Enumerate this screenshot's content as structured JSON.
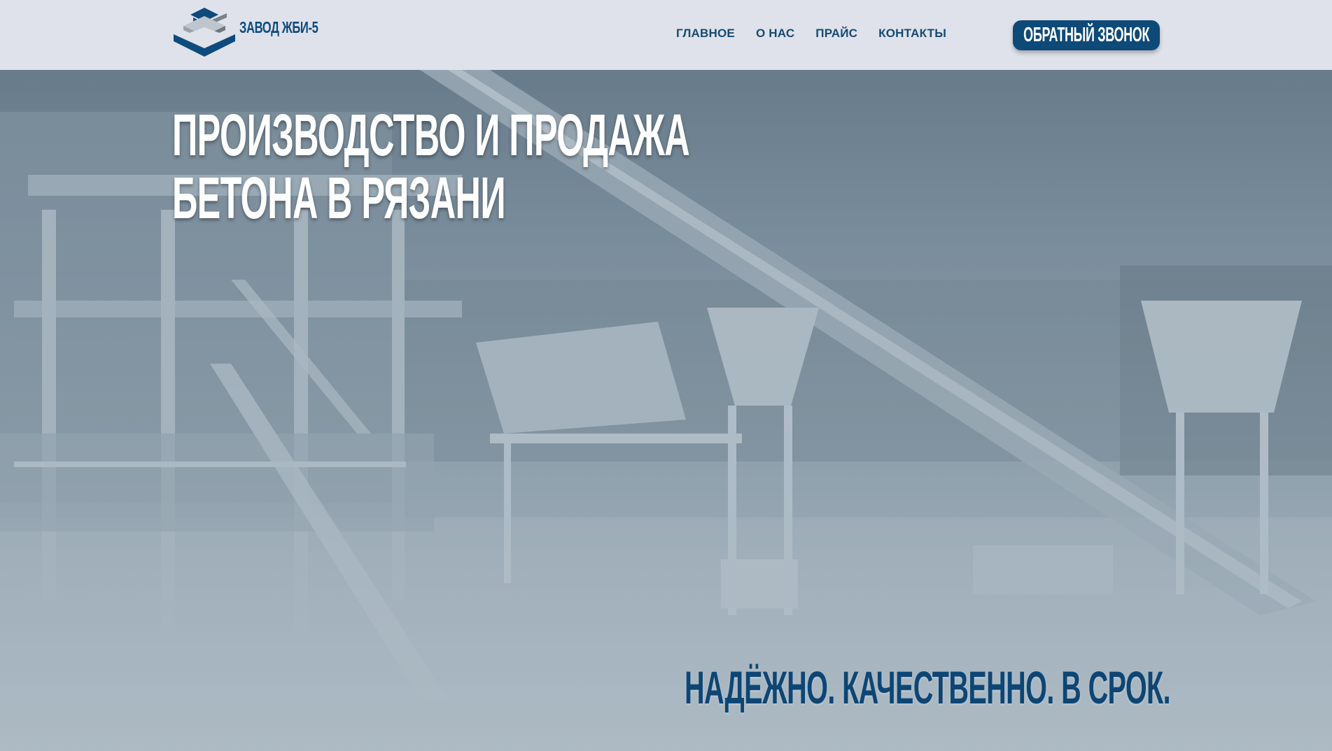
{
  "header": {
    "logo_text": "ЗАВОД ЖБИ-5",
    "nav": [
      {
        "label": "ГЛАВНОЕ"
      },
      {
        "label": "О НАС"
      },
      {
        "label": "ПРАЙС"
      },
      {
        "label": "КОНТАКТЫ"
      }
    ],
    "callback_label": "ОБРАТНЫЙ ЗВОНОК"
  },
  "hero": {
    "title_line1": "ПРОИЗВОДСТВО И ПРОДАЖА",
    "title_line2": "БЕТОНА В РЯЗАНИ",
    "slogan": "НАДЁЖНО. КАЧЕСТВЕННО. В СРОК.",
    "background": "concrete-plant-photo"
  },
  "colors": {
    "brand": "#0e4a78",
    "header_bg": "#dfe2ea",
    "nav_text": "#164a72",
    "hero_text": "#ffffff"
  }
}
